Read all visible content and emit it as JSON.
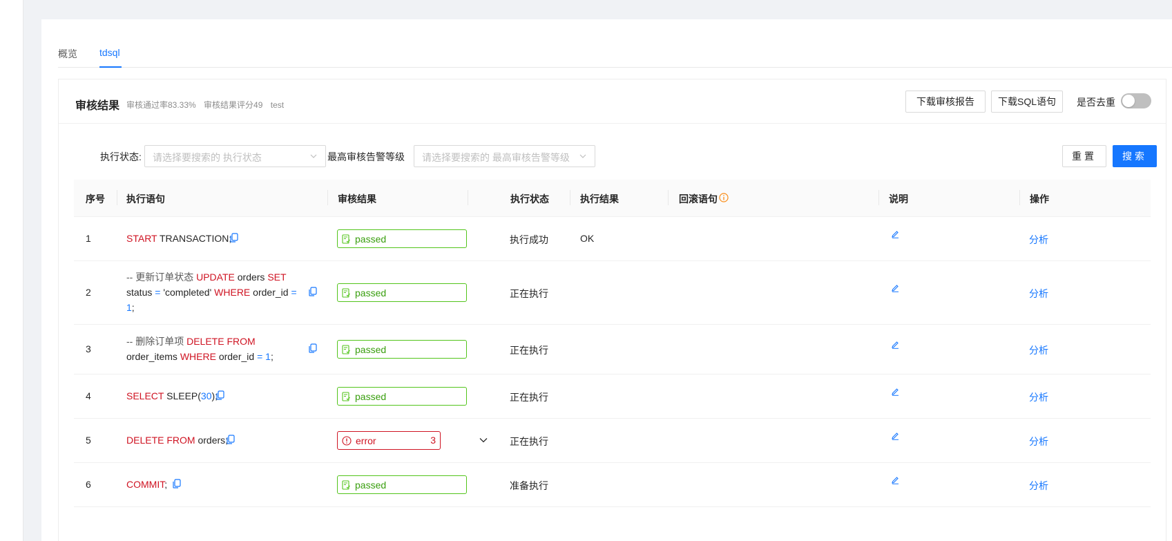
{
  "tabs": [
    {
      "label": "概览"
    },
    {
      "label": "tdsql"
    }
  ],
  "card": {
    "title": "审核结果",
    "meta": {
      "pass_rate": "审核通过率83.33%",
      "score": "审核结果评分49",
      "name": "test"
    },
    "download_report": "下载审核报告",
    "download_sql": "下载SQL语句",
    "dedupe_label": "是否去重"
  },
  "filters": {
    "exec_status_label": "执行状态:",
    "exec_status_placeholder": "请选择要搜索的 执行状态",
    "level_label": "最高审核告警等级",
    "level_placeholder": "请选择要搜索的 最高审核告警等级",
    "reset": "重置",
    "search": "搜索"
  },
  "table": {
    "headers": [
      "序号",
      "执行语句",
      "审核结果",
      "执行状态",
      "执行结果",
      "回滚语句",
      "说明",
      "操作"
    ],
    "rows": [
      {
        "idx": "1",
        "sql": [
          {
            "t": "START",
            "c": "kw"
          },
          {
            "t": " TRANSACTION;",
            "c": "str"
          }
        ],
        "audit": "passed",
        "status": "执行成功",
        "result": "OK",
        "action": "分析"
      },
      {
        "idx": "2",
        "sql": [
          {
            "t": "-- 更新订单状态 ",
            "c": "comment"
          },
          {
            "t": "UPDATE",
            "c": "kw"
          },
          {
            "t": " orders ",
            "c": "str"
          },
          {
            "t": "SET",
            "c": "kw"
          },
          {
            "t": " status ",
            "c": "str"
          },
          {
            "t": "=",
            "c": "op"
          },
          {
            "t": " 'completed' ",
            "c": "str"
          },
          {
            "t": "WHERE",
            "c": "kw"
          },
          {
            "t": " order_id ",
            "c": "str"
          },
          {
            "t": "=",
            "c": "op"
          },
          {
            "t": " ",
            "c": "str"
          },
          {
            "t": "1",
            "c": "num"
          },
          {
            "t": ";",
            "c": "str"
          }
        ],
        "audit": "passed",
        "status": "正在执行",
        "result": "",
        "action": "分析"
      },
      {
        "idx": "3",
        "sql": [
          {
            "t": "-- 删除订单项 ",
            "c": "comment"
          },
          {
            "t": "DELETE FROM",
            "c": "kw"
          },
          {
            "t": " order_items ",
            "c": "str"
          },
          {
            "t": "WHERE",
            "c": "kw"
          },
          {
            "t": " order_id ",
            "c": "str"
          },
          {
            "t": "=",
            "c": "op"
          },
          {
            "t": " ",
            "c": "str"
          },
          {
            "t": "1",
            "c": "num"
          },
          {
            "t": ";",
            "c": "str"
          }
        ],
        "audit": "passed",
        "status": "正在执行",
        "result": "",
        "action": "分析"
      },
      {
        "idx": "4",
        "sql": [
          {
            "t": "SELECT",
            "c": "kw"
          },
          {
            "t": " SLEEP(",
            "c": "str"
          },
          {
            "t": "30",
            "c": "num"
          },
          {
            "t": ");",
            "c": "str"
          }
        ],
        "audit": "passed",
        "status": "正在执行",
        "result": "",
        "action": "分析"
      },
      {
        "idx": "5",
        "sql": [
          {
            "t": "DELETE FROM",
            "c": "kw"
          },
          {
            "t": " orders;",
            "c": "str"
          }
        ],
        "audit": "error",
        "audit_count": "3",
        "status": "正在执行",
        "result": "",
        "action": "分析"
      },
      {
        "idx": "6",
        "sql": [
          {
            "t": "COMMIT",
            "c": "kw"
          },
          {
            "t": ";",
            "c": "str"
          }
        ],
        "audit": "passed",
        "status": "准备执行",
        "result": "",
        "action": "分析"
      }
    ]
  },
  "colors": {
    "primary": "#1677ff",
    "pass": "#52c41a",
    "error": "#cf1322",
    "keyword": "#cf1322"
  }
}
